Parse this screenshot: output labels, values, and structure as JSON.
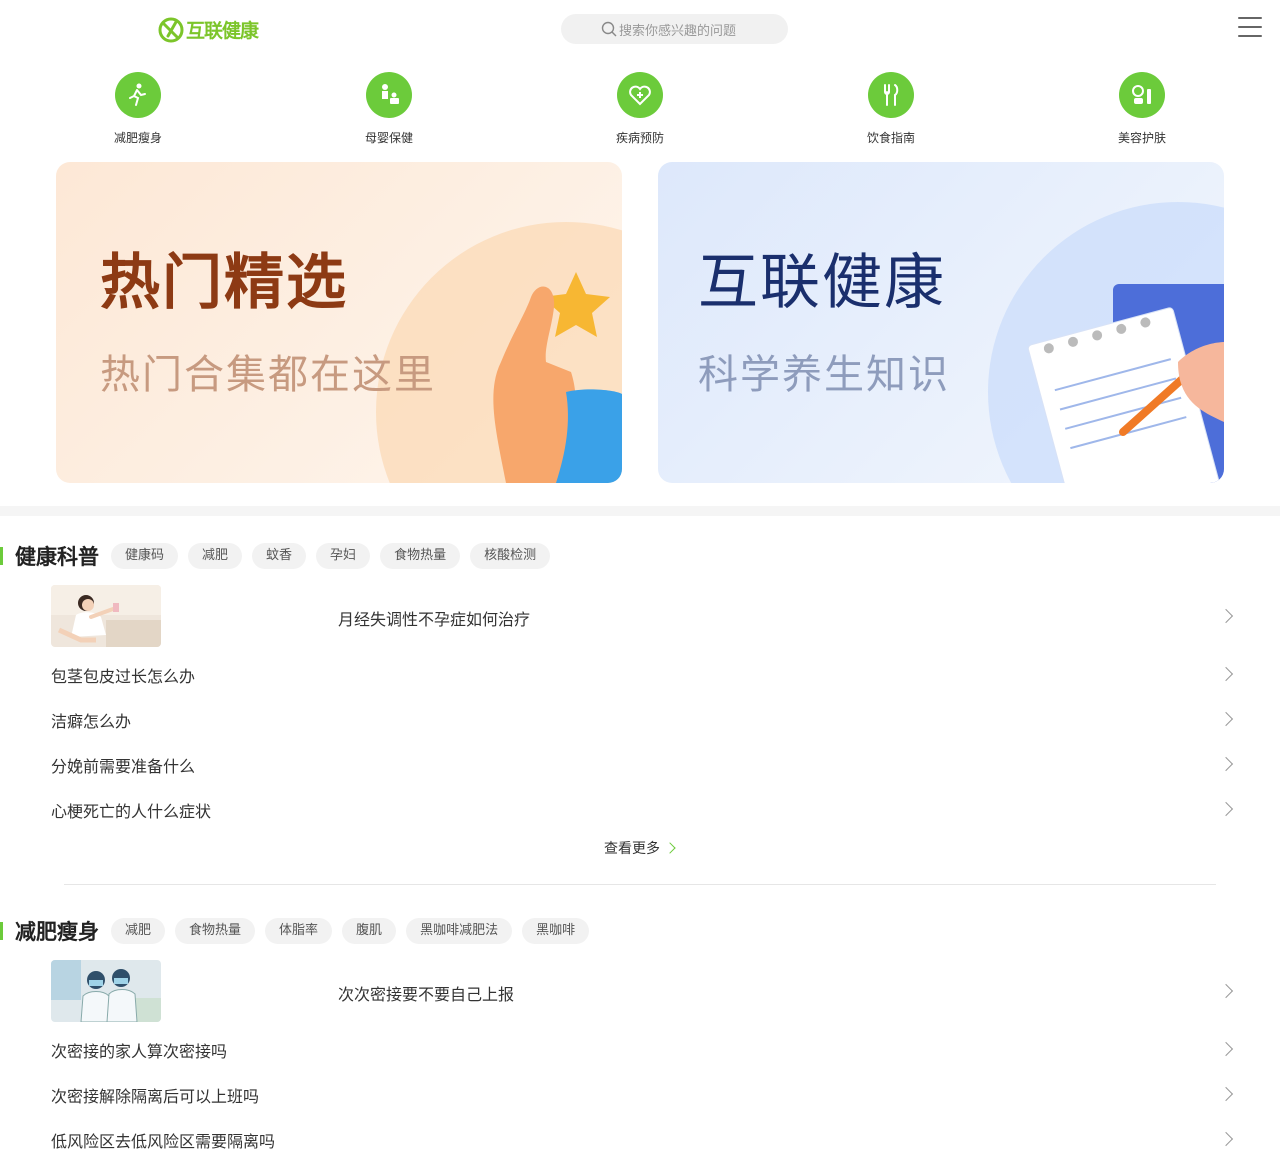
{
  "header": {
    "logo_text": "互联健康",
    "search_placeholder": "搜索你感兴趣的问题"
  },
  "categories": [
    {
      "label": "减肥瘦身",
      "icon": "running-person-icon"
    },
    {
      "label": "母婴保健",
      "icon": "mother-baby-icon"
    },
    {
      "label": "疾病预防",
      "icon": "heart-shield-icon"
    },
    {
      "label": "饮食指南",
      "icon": "fork-knife-icon"
    },
    {
      "label": "美容护肤",
      "icon": "cosmetics-icon"
    }
  ],
  "banners": [
    {
      "title": "热门精选",
      "subtitle": "热门合集都在这里"
    },
    {
      "title": "互联健康",
      "subtitle": "科学养生知识"
    }
  ],
  "sections": [
    {
      "title": "健康科普",
      "tags": [
        "健康码",
        "减肥",
        "蚊香",
        "孕妇",
        "食物热量",
        "核酸检测"
      ],
      "feature": "月经失调性不孕症如何治疗",
      "items": [
        "包茎包皮过长怎么办",
        "洁癖怎么办",
        "分娩前需要准备什么",
        "心梗死亡的人什么症状"
      ],
      "more": "查看更多"
    },
    {
      "title": "减肥瘦身",
      "tags": [
        "减肥",
        "食物热量",
        "体脂率",
        "腹肌",
        "黑咖啡减肥法",
        "黑咖啡"
      ],
      "feature": "次次密接要不要自己上报",
      "items": [
        "次密接的家人算次密接吗",
        "次密接解除隔离后可以上班吗",
        "低风险区去低风险区需要隔离吗"
      ]
    }
  ],
  "colors": {
    "accent": "#6ccb3b",
    "logo": "#7cc52a",
    "banner1_title": "#8d3a14",
    "banner2_title": "#1a2f6d"
  }
}
